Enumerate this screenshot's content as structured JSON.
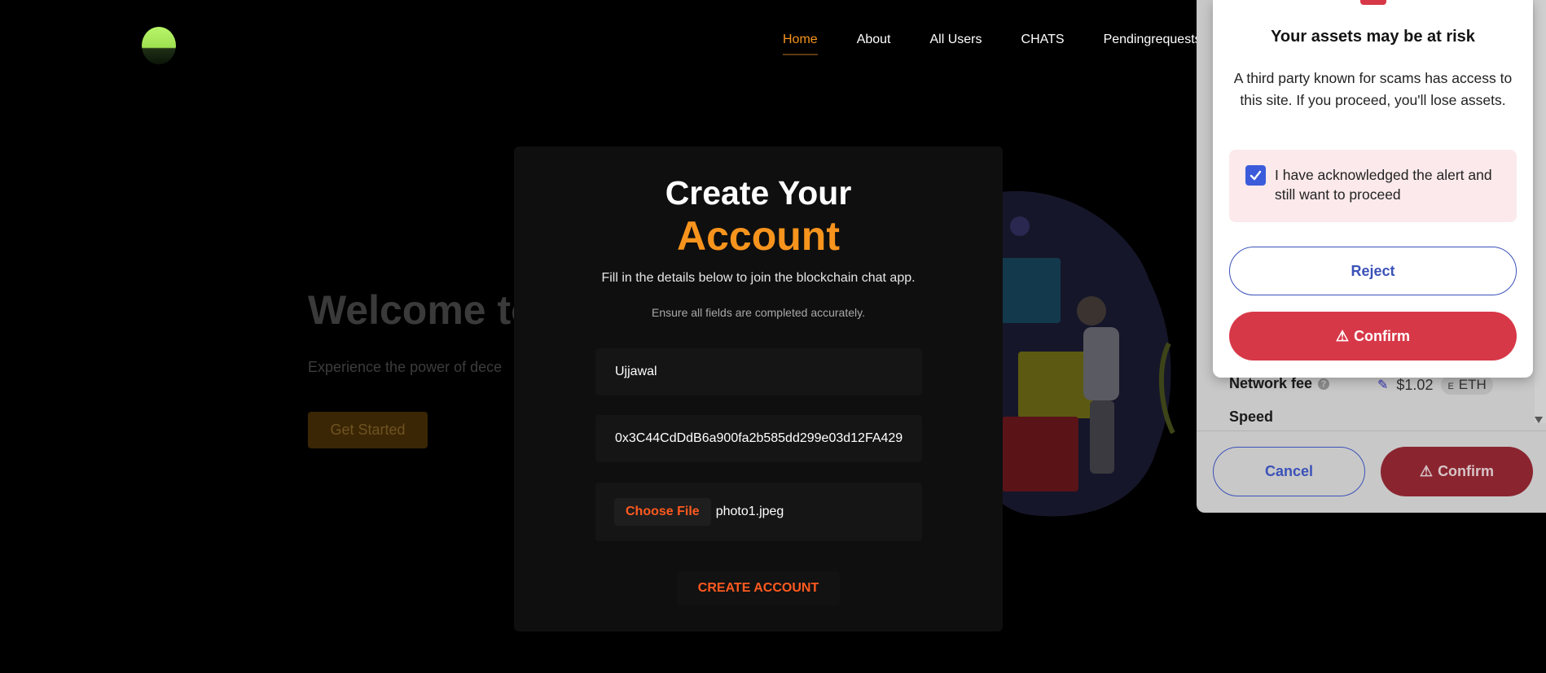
{
  "nav": {
    "items": [
      {
        "label": "Home",
        "active": true
      },
      {
        "label": "About",
        "active": false
      },
      {
        "label": "All Users",
        "active": false
      },
      {
        "label": "CHATS",
        "active": false
      },
      {
        "label": "Pendingrequests",
        "active": false
      }
    ]
  },
  "hero": {
    "title": "Welcome to",
    "subtitle": "Experience the power of dece",
    "cta_label": "Get Started"
  },
  "modal": {
    "title_line1": "Create Your",
    "title_line2": "Account",
    "description": "Fill in the details below to join the blockchain chat app.",
    "note": "Ensure all fields are completed accurately.",
    "name_value": "Ujjawal",
    "address_value": "0x3C44CdDdB6a900fa2b585dd299e03d12FA429",
    "file_button_label": "Choose File",
    "file_name": "photo1.jpeg",
    "submit_label": "CREATE ACCOUNT"
  },
  "wallet": {
    "network_fee_label": "Network fee",
    "network_fee_value": "$1.02",
    "currency_badge": "E",
    "currency_label": "ETH",
    "speed_label": "Speed",
    "cancel_label": "Cancel",
    "confirm_label": "Confirm"
  },
  "alert": {
    "title": "Your assets may be at risk",
    "body": "A third party known for scams has access to this site. If you proceed, you'll lose assets.",
    "ack_label": "I have acknowledged the alert and still want to proceed",
    "ack_checked": true,
    "reject_label": "Reject",
    "confirm_label": "Confirm"
  },
  "colors": {
    "accent_orange": "#f7941d",
    "action_red": "#ff5a1f",
    "danger": "#d73847",
    "link_blue": "#3b52b8"
  }
}
